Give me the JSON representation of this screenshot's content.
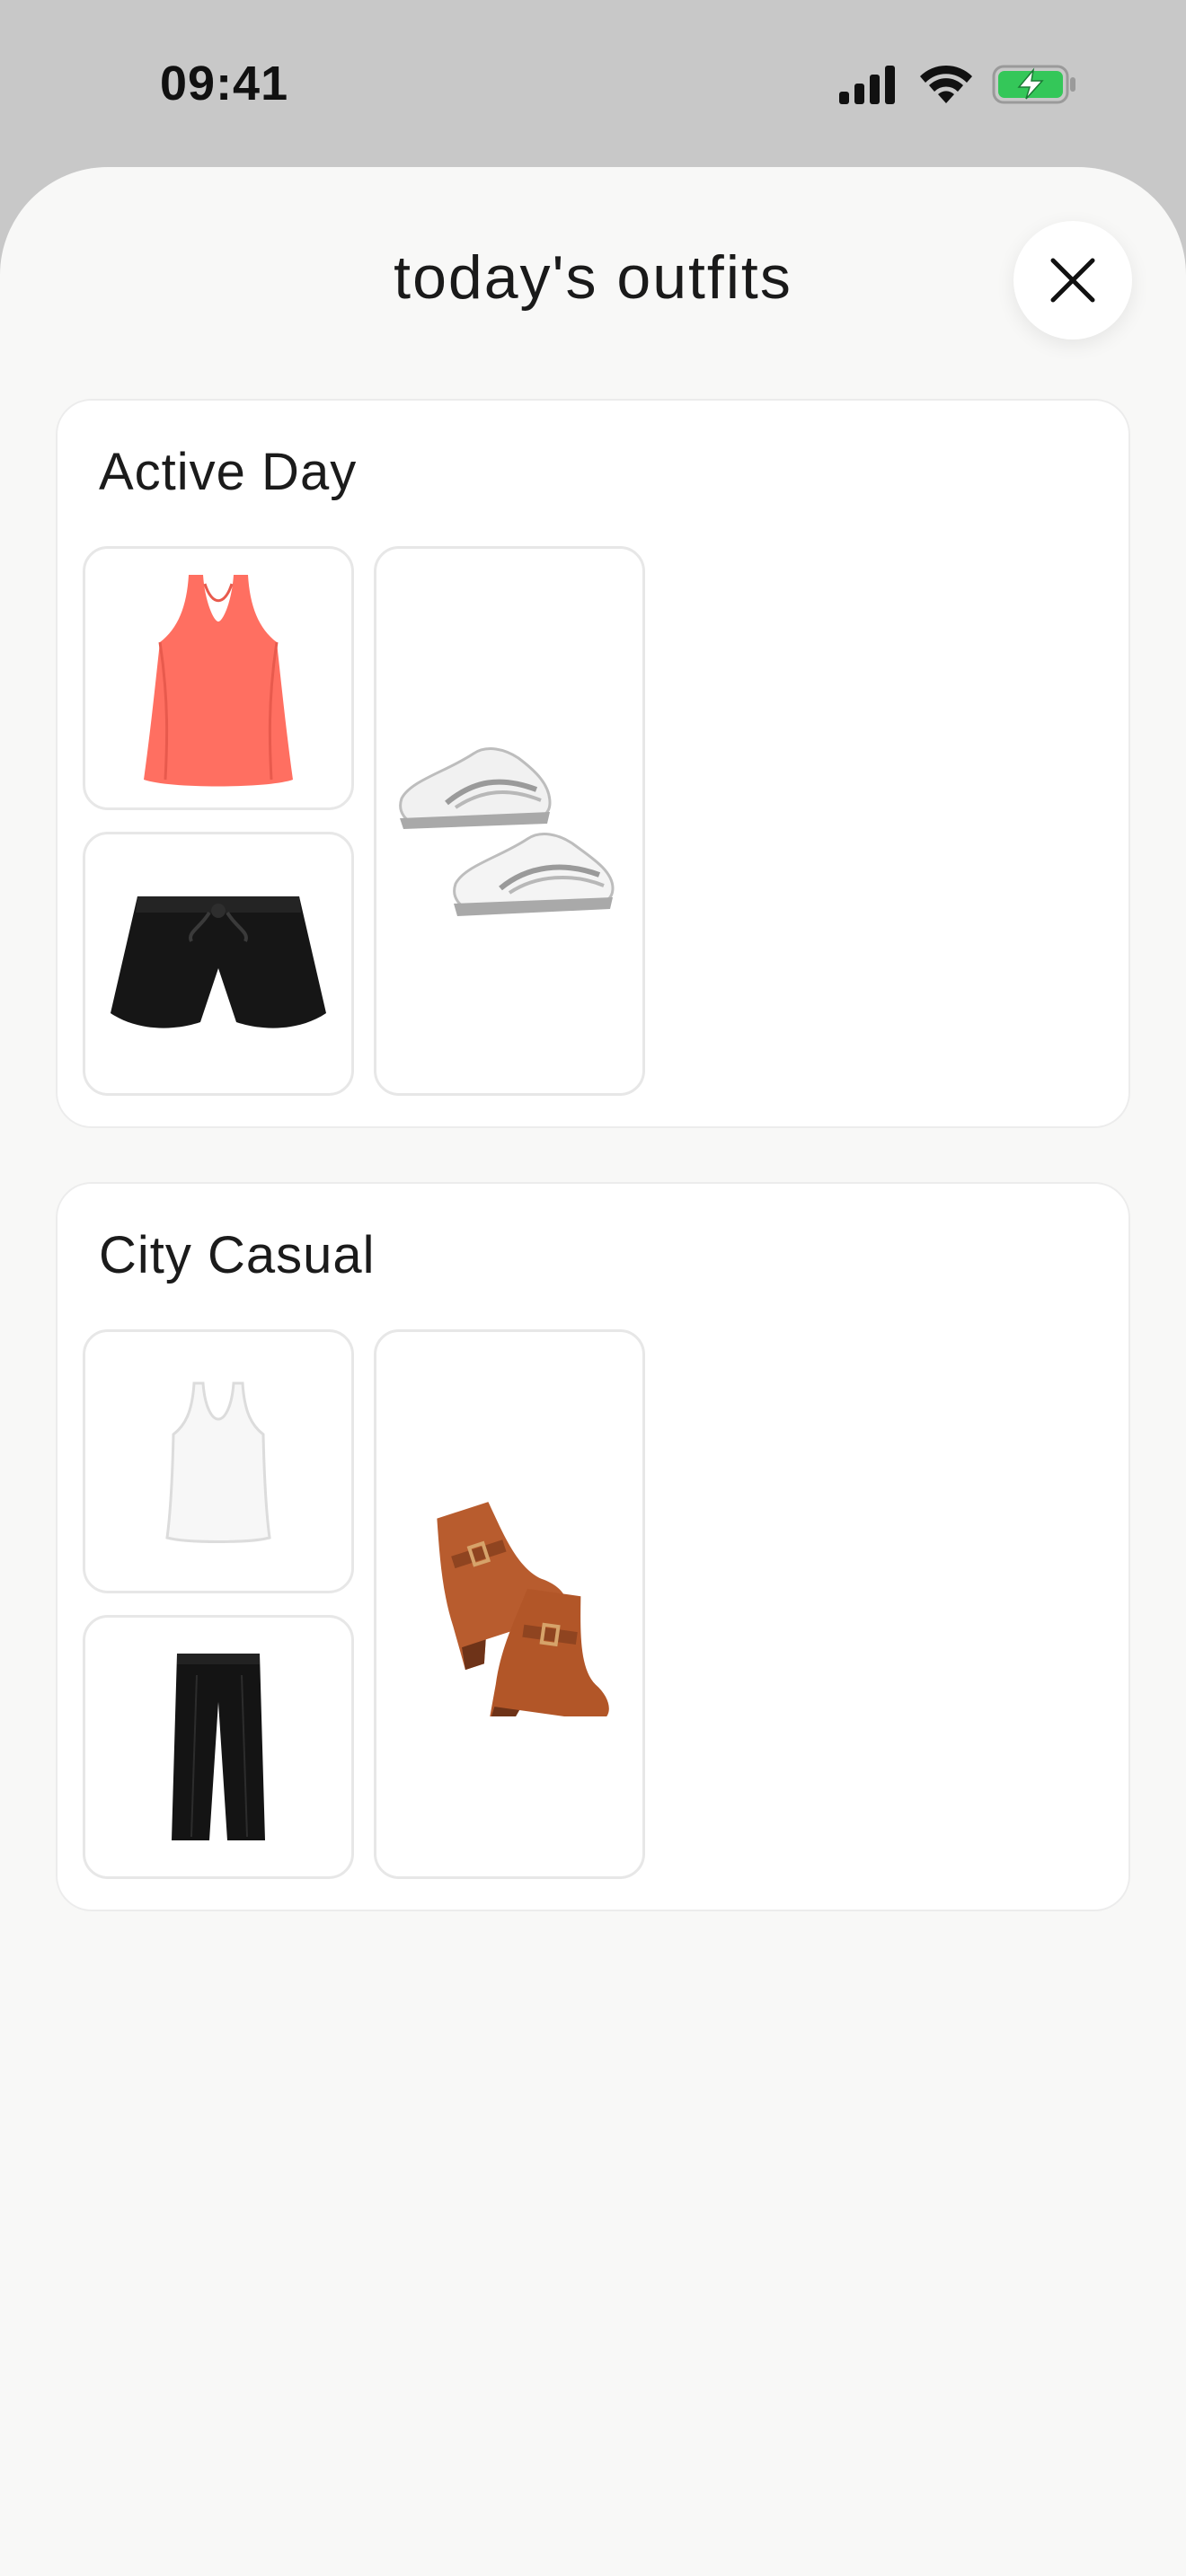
{
  "status_bar": {
    "time": "09:41",
    "icons": [
      "cellular-signal-icon",
      "wifi-icon",
      "battery-charging-icon"
    ],
    "battery_color": "#34c759"
  },
  "sheet": {
    "title": "today's outfits",
    "close_icon": "close-icon"
  },
  "outfits": [
    {
      "title": "Active Day",
      "items": [
        "coral-tank-top",
        "black-running-shorts",
        "white-running-sneakers"
      ]
    },
    {
      "title": "City Casual",
      "items": [
        "white-tank-top",
        "black-trousers",
        "brown-ankle-boots"
      ]
    }
  ],
  "colors": {
    "background": "#f8f8f7",
    "card": "#ffffff",
    "tile_border": "#e7e7e7",
    "coral": "#ff6f61",
    "boot_brown": "#b85c2e"
  }
}
